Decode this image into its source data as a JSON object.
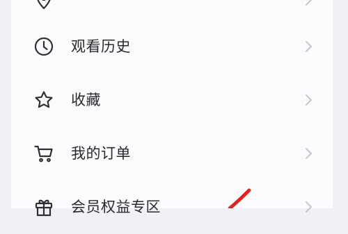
{
  "menu": {
    "items": [
      {
        "label": "",
        "icon": "location-pin-icon"
      },
      {
        "label": "观看历史",
        "icon": "clock-icon"
      },
      {
        "label": "收藏",
        "icon": "star-icon"
      },
      {
        "label": "我的订单",
        "icon": "cart-icon"
      },
      {
        "label": "会员权益专区",
        "icon": "gift-icon"
      }
    ],
    "chevron_icon": "chevron-right-icon"
  },
  "colors": {
    "page_bg": "#f0f1f5",
    "card_bg": "#fbfbfd",
    "text": "#2a2a2e",
    "icon": "#2f2f33",
    "chevron": "#c4c6cc",
    "annotation": "#e02424"
  }
}
